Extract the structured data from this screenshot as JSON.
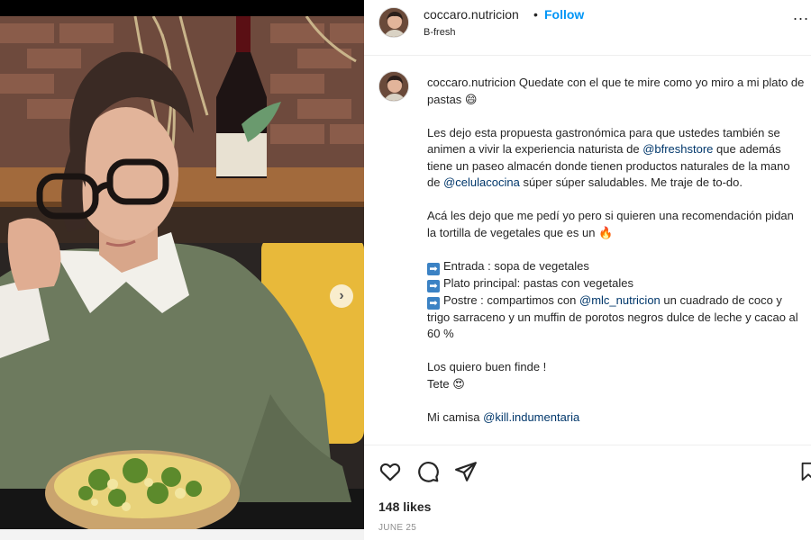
{
  "post": {
    "username": "coccaro.nutricion",
    "separator": "•",
    "follow_label": "Follow",
    "location": "B-fresh",
    "more_label": "...",
    "carousel_next": "›"
  },
  "caption": {
    "username": "coccaro.nutricion",
    "line1_text": " Quedate con el que te mire como yo miro a mi plato de pastas ",
    "p2_a": "Les dejo esta propuesta gastronómica para que ustedes también se animen a vivir la experiencia naturista de ",
    "p2_mention1": "@bfreshstore",
    "p2_b": " que además tiene un paseo almacén donde tienen productos naturales de la mano de ",
    "p2_mention2": "@celulacocina",
    "p2_c": " súper súper saludables. Me traje de to-do.",
    "p3": "Acá les dejo que me pedí yo pero si quieren una recomendación pidan la tortilla de vegetales que es un ",
    "item1": "Entrada : sopa de vegetales",
    "item2": "Plato principal: pastas con vegetales",
    "item3_a": "Postre : compartimos con ",
    "item3_mention": "@mlc_nutricion",
    "item3_b": " un cuadrado de coco y trigo sarraceno y un muffin de porotos negros dulce de leche y cacao al 60 %",
    "p5_a": "Los quiero buen finde !",
    "p5_b": "Tete ",
    "p6_a": "Mi camisa ",
    "p6_mention": "@kill.indumentaria",
    "emoji_laugh": "😄",
    "emoji_fire": "🔥",
    "emoji_love": "😍",
    "arrow": "➡"
  },
  "engagement": {
    "likes": "148 likes",
    "date": "JUNE 25"
  },
  "icons": [
    "heart-icon",
    "comment-icon",
    "share-icon",
    "bookmark-icon",
    "more-icon"
  ],
  "colors": {
    "link_blue": "#0095f6",
    "mention": "#00376b",
    "text": "#262626",
    "muted": "#8e8e8e"
  }
}
